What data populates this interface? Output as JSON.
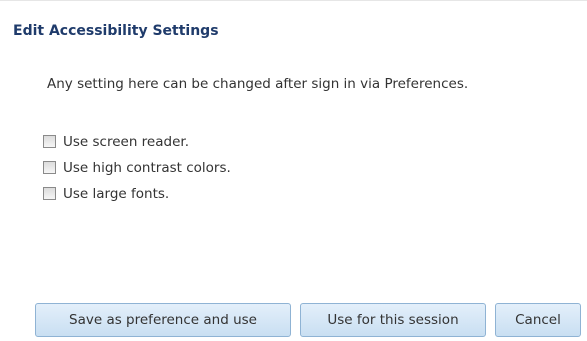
{
  "dialog": {
    "title": "Edit Accessibility Settings",
    "intro": "Any setting here can be changed after sign in via Preferences."
  },
  "options": [
    {
      "label": "Use screen reader.",
      "checked": false
    },
    {
      "label": "Use high contrast colors.",
      "checked": false
    },
    {
      "label": "Use large fonts.",
      "checked": false
    }
  ],
  "buttons": {
    "save_pref": "Save as preference and use",
    "session": "Use for this session",
    "cancel": "Cancel"
  },
  "colors": {
    "title": "#1f3b6b",
    "button_border": "#8fb3d4",
    "button_fill": "#d6e7f7"
  }
}
